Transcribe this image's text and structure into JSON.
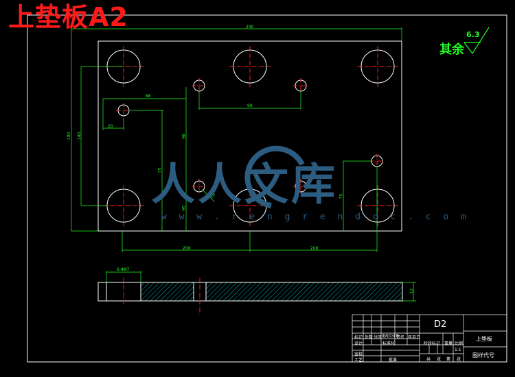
{
  "title": "上垫板A2",
  "roughness": {
    "label": "其余",
    "value": "6.3"
  },
  "dimensions": {
    "overall_width": "240",
    "overall_height": "190",
    "hole_row_height": "140",
    "top_hole_spacing": "90",
    "offset_88": "88",
    "offset_20": "20",
    "vertical_90": "90",
    "vertical_75_left": "75",
    "vertical_95": "95",
    "vertical_75_right": "75",
    "pin_dia": "10",
    "bottom_left_span": "200",
    "bottom_right_span": "200",
    "section_callout": "6-Φ87",
    "section_thickness": "12"
  },
  "watermark": {
    "text_cn": "人人文库",
    "url": "w w w . r e n g r e n d o c . c o m"
  },
  "title_block": {
    "code": "D2",
    "part_name": "上垫板",
    "drawing_no_label": "图样代号",
    "scale": "1:1",
    "cells": [
      "标记",
      "处数",
      "分区",
      "更改文件号",
      "签名",
      "年月日",
      "设计",
      "标准化",
      "阶段标记",
      "重量",
      "比例",
      "审核",
      "工艺",
      "批准",
      "共",
      "张",
      "第",
      "张"
    ]
  },
  "colors": {
    "outline": "#ffffff",
    "dimension": "#22ff22",
    "center": "#ff2020",
    "title": "#ff1a1a",
    "hatch": "#00e0e0"
  }
}
